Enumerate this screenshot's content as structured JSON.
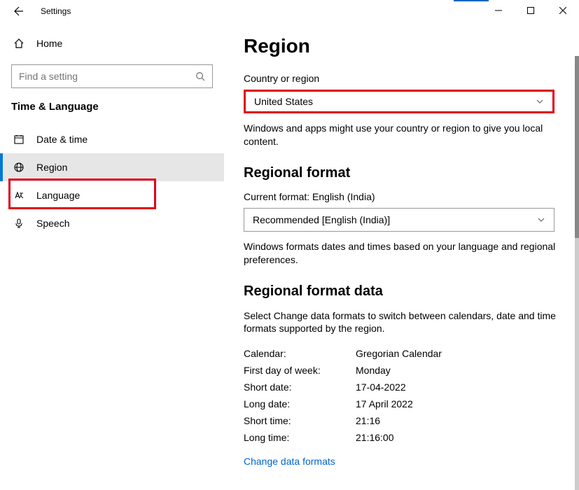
{
  "window": {
    "title": "Settings"
  },
  "sidebar": {
    "home_label": "Home",
    "search_placeholder": "Find a setting",
    "category": "Time & Language",
    "items": [
      {
        "label": "Date & time"
      },
      {
        "label": "Region"
      },
      {
        "label": "Language"
      },
      {
        "label": "Speech"
      }
    ]
  },
  "content": {
    "page_title": "Region",
    "country_label": "Country or region",
    "country_value": "United States",
    "country_hint": "Windows and apps might use your country or region to give you local content.",
    "regional_format_heading": "Regional format",
    "current_format_label": "Current format: English (India)",
    "format_dropdown_value": "Recommended [English (India)]",
    "format_hint": "Windows formats dates and times based on your language and regional preferences.",
    "format_data_heading": "Regional format data",
    "format_data_hint": "Select Change data formats to switch between calendars, date and time formats supported by the region.",
    "rows": [
      {
        "k": "Calendar:",
        "v": "Gregorian Calendar"
      },
      {
        "k": "First day of week:",
        "v": "Monday"
      },
      {
        "k": "Short date:",
        "v": "17-04-2022"
      },
      {
        "k": "Long date:",
        "v": "17 April 2022"
      },
      {
        "k": "Short time:",
        "v": "21:16"
      },
      {
        "k": "Long time:",
        "v": "21:16:00"
      }
    ],
    "change_formats_link": "Change data formats"
  }
}
